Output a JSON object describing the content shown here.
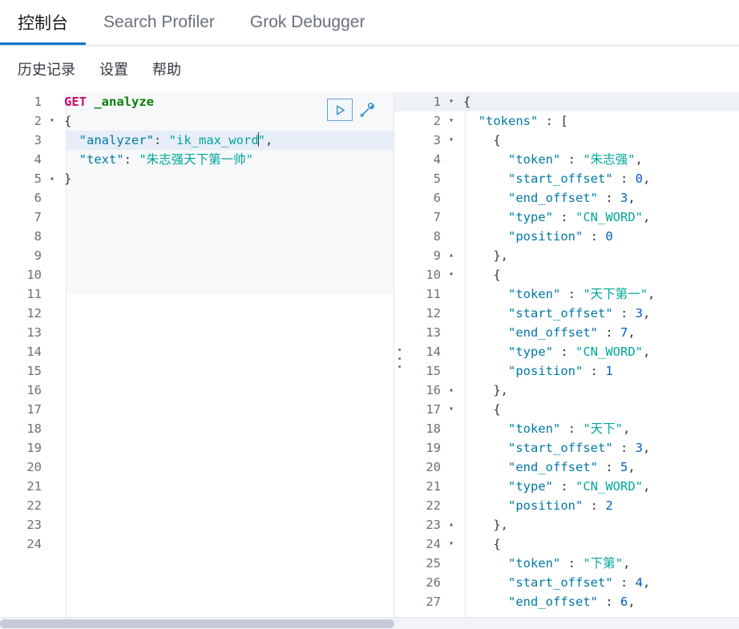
{
  "tabs": [
    {
      "label": "控制台",
      "selected": true
    },
    {
      "label": "Search Profiler",
      "selected": false
    },
    {
      "label": "Grok Debugger",
      "selected": false
    }
  ],
  "submenu": [
    {
      "label": "历史记录"
    },
    {
      "label": "设置"
    },
    {
      "label": "帮助"
    }
  ],
  "editor": {
    "actions": {
      "play": "play-icon",
      "wrench": "wrench-icon"
    },
    "highlighted_line": 3,
    "caret_line": 3,
    "lines": [
      {
        "num": "1",
        "fold": "",
        "tokens": [
          {
            "t": "GET ",
            "c": "k-method"
          },
          {
            "t": "_analyze",
            "c": "k-url"
          }
        ]
      },
      {
        "num": "2",
        "fold": "▾",
        "tokens": [
          {
            "t": "{",
            "c": "k-punct"
          }
        ]
      },
      {
        "num": "3",
        "fold": "",
        "tokens": [
          {
            "t": "  ",
            "c": "k-plain"
          },
          {
            "t": "\"analyzer\"",
            "c": "k-key"
          },
          {
            "t": ": ",
            "c": "k-punct"
          },
          {
            "t": "\"ik_max_word",
            "c": "k-str"
          },
          {
            "t": "CARET",
            "c": "caret"
          },
          {
            "t": "\"",
            "c": "k-str"
          },
          {
            "t": ",",
            "c": "k-punct"
          }
        ]
      },
      {
        "num": "4",
        "fold": "",
        "tokens": [
          {
            "t": "  ",
            "c": "k-plain"
          },
          {
            "t": "\"text\"",
            "c": "k-key"
          },
          {
            "t": ": ",
            "c": "k-punct"
          },
          {
            "t": "\"朱志强天下第一帅\"",
            "c": "k-str"
          }
        ]
      },
      {
        "num": "5",
        "fold": "▴",
        "tokens": [
          {
            "t": "}",
            "c": "k-punct"
          }
        ]
      },
      {
        "num": "6",
        "fold": "",
        "tokens": []
      },
      {
        "num": "7",
        "fold": "",
        "tokens": []
      },
      {
        "num": "8",
        "fold": "",
        "tokens": []
      },
      {
        "num": "9",
        "fold": "",
        "tokens": []
      },
      {
        "num": "10",
        "fold": "",
        "tokens": []
      },
      {
        "num": "11",
        "fold": "",
        "tokens": []
      },
      {
        "num": "12",
        "fold": "",
        "tokens": []
      },
      {
        "num": "13",
        "fold": "",
        "tokens": []
      },
      {
        "num": "14",
        "fold": "",
        "tokens": []
      },
      {
        "num": "15",
        "fold": "",
        "tokens": []
      },
      {
        "num": "16",
        "fold": "",
        "tokens": []
      },
      {
        "num": "17",
        "fold": "",
        "tokens": []
      },
      {
        "num": "18",
        "fold": "",
        "tokens": []
      },
      {
        "num": "19",
        "fold": "",
        "tokens": []
      },
      {
        "num": "20",
        "fold": "",
        "tokens": []
      },
      {
        "num": "21",
        "fold": "",
        "tokens": []
      },
      {
        "num": "22",
        "fold": "",
        "tokens": []
      },
      {
        "num": "23",
        "fold": "",
        "tokens": []
      },
      {
        "num": "24",
        "fold": "",
        "tokens": []
      }
    ]
  },
  "response": {
    "lines": [
      {
        "num": "1",
        "fold": "▾",
        "tokens": [
          {
            "t": "{",
            "c": "k-punct"
          }
        ]
      },
      {
        "num": "2",
        "fold": "▾",
        "tokens": [
          {
            "t": "  ",
            "c": "k-plain"
          },
          {
            "t": "\"tokens\"",
            "c": "k-key"
          },
          {
            "t": " : ",
            "c": "k-punct"
          },
          {
            "t": "[",
            "c": "k-punct"
          }
        ]
      },
      {
        "num": "3",
        "fold": "▾",
        "tokens": [
          {
            "t": "    ",
            "c": "k-plain"
          },
          {
            "t": "{",
            "c": "k-punct"
          }
        ]
      },
      {
        "num": "4",
        "fold": "",
        "tokens": [
          {
            "t": "      ",
            "c": "k-plain"
          },
          {
            "t": "\"token\"",
            "c": "k-key"
          },
          {
            "t": " : ",
            "c": "k-punct"
          },
          {
            "t": "\"朱志强\"",
            "c": "k-str"
          },
          {
            "t": ",",
            "c": "k-punct"
          }
        ]
      },
      {
        "num": "5",
        "fold": "",
        "tokens": [
          {
            "t": "      ",
            "c": "k-plain"
          },
          {
            "t": "\"start_offset\"",
            "c": "k-key"
          },
          {
            "t": " : ",
            "c": "k-punct"
          },
          {
            "t": "0",
            "c": "k-num"
          },
          {
            "t": ",",
            "c": "k-punct"
          }
        ]
      },
      {
        "num": "6",
        "fold": "",
        "tokens": [
          {
            "t": "      ",
            "c": "k-plain"
          },
          {
            "t": "\"end_offset\"",
            "c": "k-key"
          },
          {
            "t": " : ",
            "c": "k-punct"
          },
          {
            "t": "3",
            "c": "k-num"
          },
          {
            "t": ",",
            "c": "k-punct"
          }
        ]
      },
      {
        "num": "7",
        "fold": "",
        "tokens": [
          {
            "t": "      ",
            "c": "k-plain"
          },
          {
            "t": "\"type\"",
            "c": "k-key"
          },
          {
            "t": " : ",
            "c": "k-punct"
          },
          {
            "t": "\"CN_WORD\"",
            "c": "k-str"
          },
          {
            "t": ",",
            "c": "k-punct"
          }
        ]
      },
      {
        "num": "8",
        "fold": "",
        "tokens": [
          {
            "t": "      ",
            "c": "k-plain"
          },
          {
            "t": "\"position\"",
            "c": "k-key"
          },
          {
            "t": " : ",
            "c": "k-punct"
          },
          {
            "t": "0",
            "c": "k-num"
          }
        ]
      },
      {
        "num": "9",
        "fold": "▴",
        "tokens": [
          {
            "t": "    ",
            "c": "k-plain"
          },
          {
            "t": "},",
            "c": "k-punct"
          }
        ]
      },
      {
        "num": "10",
        "fold": "▾",
        "tokens": [
          {
            "t": "    ",
            "c": "k-plain"
          },
          {
            "t": "{",
            "c": "k-punct"
          }
        ]
      },
      {
        "num": "11",
        "fold": "",
        "tokens": [
          {
            "t": "      ",
            "c": "k-plain"
          },
          {
            "t": "\"token\"",
            "c": "k-key"
          },
          {
            "t": " : ",
            "c": "k-punct"
          },
          {
            "t": "\"天下第一\"",
            "c": "k-str"
          },
          {
            "t": ",",
            "c": "k-punct"
          }
        ]
      },
      {
        "num": "12",
        "fold": "",
        "tokens": [
          {
            "t": "      ",
            "c": "k-plain"
          },
          {
            "t": "\"start_offset\"",
            "c": "k-key"
          },
          {
            "t": " : ",
            "c": "k-punct"
          },
          {
            "t": "3",
            "c": "k-num"
          },
          {
            "t": ",",
            "c": "k-punct"
          }
        ]
      },
      {
        "num": "13",
        "fold": "",
        "tokens": [
          {
            "t": "      ",
            "c": "k-plain"
          },
          {
            "t": "\"end_offset\"",
            "c": "k-key"
          },
          {
            "t": " : ",
            "c": "k-punct"
          },
          {
            "t": "7",
            "c": "k-num"
          },
          {
            "t": ",",
            "c": "k-punct"
          }
        ]
      },
      {
        "num": "14",
        "fold": "",
        "tokens": [
          {
            "t": "      ",
            "c": "k-plain"
          },
          {
            "t": "\"type\"",
            "c": "k-key"
          },
          {
            "t": " : ",
            "c": "k-punct"
          },
          {
            "t": "\"CN_WORD\"",
            "c": "k-str"
          },
          {
            "t": ",",
            "c": "k-punct"
          }
        ]
      },
      {
        "num": "15",
        "fold": "",
        "tokens": [
          {
            "t": "      ",
            "c": "k-plain"
          },
          {
            "t": "\"position\"",
            "c": "k-key"
          },
          {
            "t": " : ",
            "c": "k-punct"
          },
          {
            "t": "1",
            "c": "k-num"
          }
        ]
      },
      {
        "num": "16",
        "fold": "▴",
        "tokens": [
          {
            "t": "    ",
            "c": "k-plain"
          },
          {
            "t": "},",
            "c": "k-punct"
          }
        ]
      },
      {
        "num": "17",
        "fold": "▾",
        "tokens": [
          {
            "t": "    ",
            "c": "k-plain"
          },
          {
            "t": "{",
            "c": "k-punct"
          }
        ]
      },
      {
        "num": "18",
        "fold": "",
        "tokens": [
          {
            "t": "      ",
            "c": "k-plain"
          },
          {
            "t": "\"token\"",
            "c": "k-key"
          },
          {
            "t": " : ",
            "c": "k-punct"
          },
          {
            "t": "\"天下\"",
            "c": "k-str"
          },
          {
            "t": ",",
            "c": "k-punct"
          }
        ]
      },
      {
        "num": "19",
        "fold": "",
        "tokens": [
          {
            "t": "      ",
            "c": "k-plain"
          },
          {
            "t": "\"start_offset\"",
            "c": "k-key"
          },
          {
            "t": " : ",
            "c": "k-punct"
          },
          {
            "t": "3",
            "c": "k-num"
          },
          {
            "t": ",",
            "c": "k-punct"
          }
        ]
      },
      {
        "num": "20",
        "fold": "",
        "tokens": [
          {
            "t": "      ",
            "c": "k-plain"
          },
          {
            "t": "\"end_offset\"",
            "c": "k-key"
          },
          {
            "t": " : ",
            "c": "k-punct"
          },
          {
            "t": "5",
            "c": "k-num"
          },
          {
            "t": ",",
            "c": "k-punct"
          }
        ]
      },
      {
        "num": "21",
        "fold": "",
        "tokens": [
          {
            "t": "      ",
            "c": "k-plain"
          },
          {
            "t": "\"type\"",
            "c": "k-key"
          },
          {
            "t": " : ",
            "c": "k-punct"
          },
          {
            "t": "\"CN_WORD\"",
            "c": "k-str"
          },
          {
            "t": ",",
            "c": "k-punct"
          }
        ]
      },
      {
        "num": "22",
        "fold": "",
        "tokens": [
          {
            "t": "      ",
            "c": "k-plain"
          },
          {
            "t": "\"position\"",
            "c": "k-key"
          },
          {
            "t": " : ",
            "c": "k-punct"
          },
          {
            "t": "2",
            "c": "k-num"
          }
        ]
      },
      {
        "num": "23",
        "fold": "▴",
        "tokens": [
          {
            "t": "    ",
            "c": "k-plain"
          },
          {
            "t": "},",
            "c": "k-punct"
          }
        ]
      },
      {
        "num": "24",
        "fold": "▾",
        "tokens": [
          {
            "t": "    ",
            "c": "k-plain"
          },
          {
            "t": "{",
            "c": "k-punct"
          }
        ]
      },
      {
        "num": "25",
        "fold": "",
        "tokens": [
          {
            "t": "      ",
            "c": "k-plain"
          },
          {
            "t": "\"token\"",
            "c": "k-key"
          },
          {
            "t": " : ",
            "c": "k-punct"
          },
          {
            "t": "\"下第\"",
            "c": "k-str"
          },
          {
            "t": ",",
            "c": "k-punct"
          }
        ]
      },
      {
        "num": "26",
        "fold": "",
        "tokens": [
          {
            "t": "      ",
            "c": "k-plain"
          },
          {
            "t": "\"start_offset\"",
            "c": "k-key"
          },
          {
            "t": " : ",
            "c": "k-punct"
          },
          {
            "t": "4",
            "c": "k-num"
          },
          {
            "t": ",",
            "c": "k-punct"
          }
        ]
      },
      {
        "num": "27",
        "fold": "",
        "tokens": [
          {
            "t": "      ",
            "c": "k-plain"
          },
          {
            "t": "\"end_offset\"",
            "c": "k-key"
          },
          {
            "t": " : ",
            "c": "k-punct"
          },
          {
            "t": "6",
            "c": "k-num"
          },
          {
            "t": ",",
            "c": "k-punct"
          }
        ]
      }
    ]
  },
  "colors": {
    "accent": "#0079a5",
    "tab_underline": "#0077cc",
    "method": "#c80a68",
    "url": "#0a7e07",
    "key": "#0079a5",
    "string": "#00a69b",
    "number": "#005cc5",
    "highlight_row": "#e7eef7",
    "editor_bg": "#f7f8fa"
  },
  "scrollbar": {
    "name": "horizontal-scrollbar"
  }
}
